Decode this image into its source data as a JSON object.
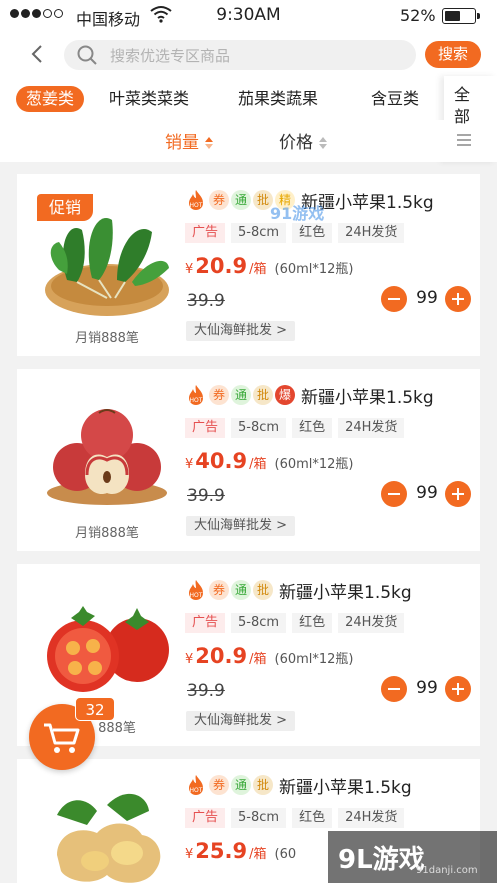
{
  "status_bar": {
    "carrier": "中国移动",
    "time": "9:30AM",
    "battery": "52%"
  },
  "search": {
    "placeholder": "搜索优选专区商品",
    "button": "搜索"
  },
  "categories": [
    "葱姜类",
    "叶菜类菜类",
    "茄果类蔬果",
    "含豆类"
  ],
  "all_label": "全部",
  "sort": {
    "sales": "销量",
    "price": "价格"
  },
  "products": [
    {
      "name": "新疆小苹果1.5kg",
      "tags": [
        "hot",
        "券",
        "通",
        "批",
        "精"
      ],
      "promo": "促销",
      "attrs": [
        "广告",
        "5-8cm",
        "红色",
        "24H发货"
      ],
      "price": "20.9",
      "unit": "/箱",
      "spec": "(60ml*12瓶)",
      "old_price": "39.9",
      "qty": "99",
      "seller": "大仙海鲜批发 >",
      "monthly_sales": "月销888笔",
      "image": "spinach"
    },
    {
      "name": "新疆小苹果1.5kg",
      "tags": [
        "hot",
        "券",
        "通",
        "批",
        "爆"
      ],
      "attrs": [
        "广告",
        "5-8cm",
        "红色",
        "24H发货"
      ],
      "price": "40.9",
      "unit": "/箱",
      "spec": "(60ml*12瓶)",
      "old_price": "39.9",
      "qty": "99",
      "seller": "大仙海鲜批发 >",
      "monthly_sales": "月销888笔",
      "image": "apples"
    },
    {
      "name": "新疆小苹果1.5kg",
      "tags": [
        "hot",
        "券",
        "通",
        "批"
      ],
      "attrs": [
        "广告",
        "5-8cm",
        "红色",
        "24H发货"
      ],
      "price": "20.9",
      "unit": "/箱",
      "spec": "(60ml*12瓶)",
      "old_price": "39.9",
      "qty": "99",
      "seller": "大仙海鲜批发 >",
      "monthly_sales": "888笔",
      "image": "tomatoes"
    },
    {
      "name": "新疆小苹果1.5kg",
      "tags": [
        "hot",
        "券",
        "通",
        "批"
      ],
      "attrs": [
        "广告",
        "5-8cm",
        "红色",
        "24H发货"
      ],
      "price": "25.9",
      "unit": "/箱",
      "spec": "(60",
      "image": "ginger"
    }
  ],
  "hot_label": "HOT",
  "cart": {
    "badge": "32"
  },
  "watermark": {
    "logo": "9L游戏",
    "domain": "91danji.com",
    "overlay": "91游戏"
  },
  "colors": {
    "accent": "#f26a21",
    "price": "#e64322"
  }
}
